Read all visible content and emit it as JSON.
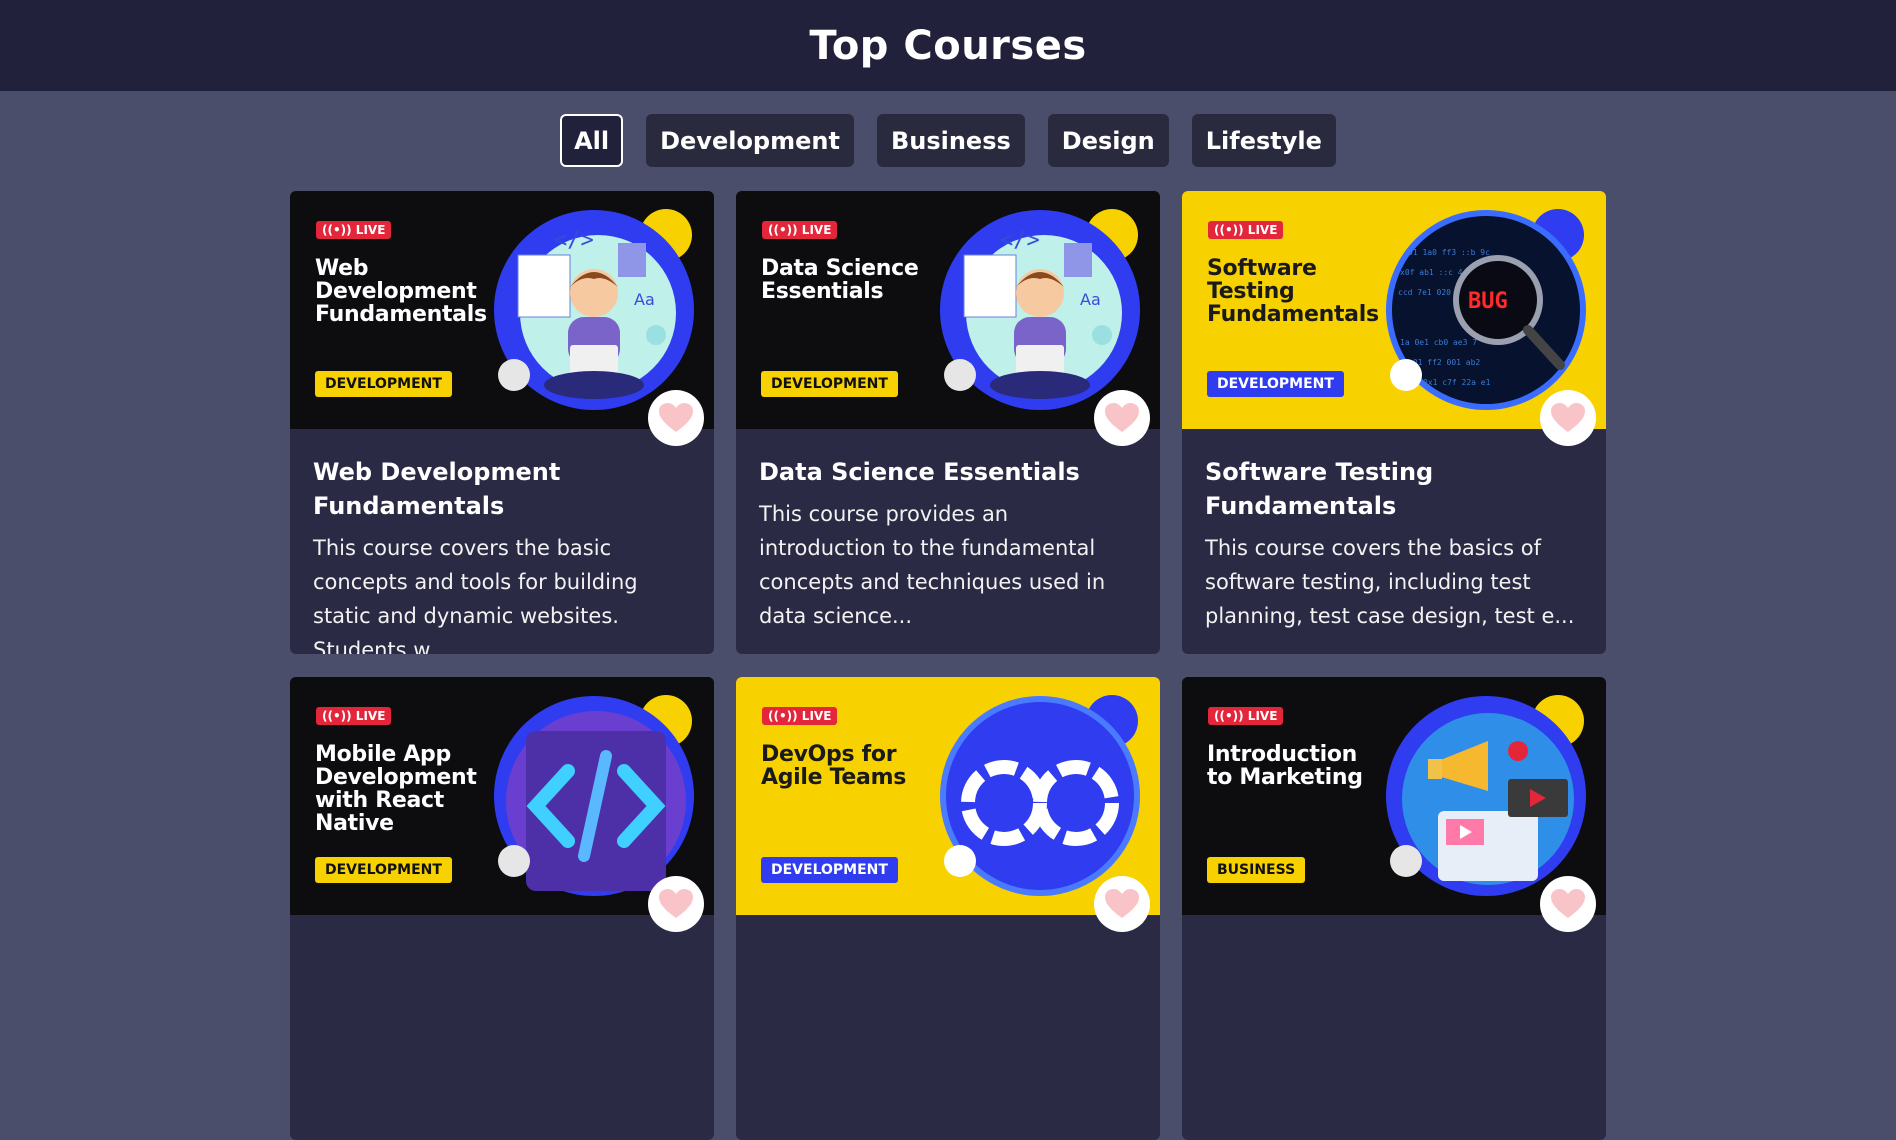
{
  "header": {
    "title": "Top Courses"
  },
  "filters": [
    {
      "label": "All",
      "active": true
    },
    {
      "label": "Development",
      "active": false
    },
    {
      "label": "Business",
      "active": false
    },
    {
      "label": "Design",
      "active": false
    },
    {
      "label": "Lifestyle",
      "active": false
    }
  ],
  "courses": [
    {
      "live": "LIVE",
      "thumb_title": "Web Development Fundamentals",
      "category": "DEVELOPMENT",
      "title": "Web Development Fundamentals",
      "description": "This course covers the basic concepts and tools for building static and dynamic websites. Students w...",
      "theme": "dark",
      "art": "developer-illustration"
    },
    {
      "live": "LIVE",
      "thumb_title": "Data Science Essentials",
      "category": "DEVELOPMENT",
      "title": "Data Science Essentials",
      "description": "This course provides an introduction to the fundamental concepts and techniques used in data science...",
      "theme": "dark",
      "art": "developer-illustration"
    },
    {
      "live": "LIVE",
      "thumb_title": "Software Testing Fundamentals",
      "category": "DEVELOPMENT",
      "title": "Software Testing Fundamentals",
      "description": "This course covers the basics of software testing, including test planning, test case design, test e...",
      "theme": "yellow",
      "art": "bug-magnifier-illustration"
    },
    {
      "live": "LIVE",
      "thumb_title": "Mobile App Development with React Native",
      "category": "DEVELOPMENT",
      "title": "",
      "description": "",
      "theme": "dark",
      "art": "code-brackets-illustration"
    },
    {
      "live": "LIVE",
      "thumb_title": "DevOps for Agile Teams",
      "category": "DEVELOPMENT",
      "title": "",
      "description": "",
      "theme": "yellow",
      "art": "infinity-loop-illustration"
    },
    {
      "live": "LIVE",
      "thumb_title": "Introduction to Marketing",
      "category": "BUSINESS",
      "title": "",
      "description": "",
      "theme": "dark",
      "art": "marketing-illustration"
    }
  ],
  "icons": {
    "favorite": "heart-icon",
    "live": "broadcast-icon"
  },
  "colors": {
    "live_badge": "#e3263a",
    "accent_blue": "#2f3cf0",
    "accent_yellow": "#f7d200"
  }
}
